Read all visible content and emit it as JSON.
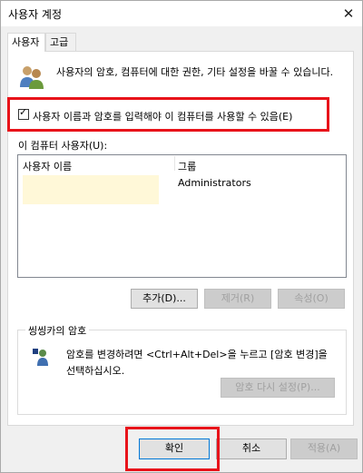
{
  "window": {
    "title": "사용자 계정",
    "close_glyph": "✕"
  },
  "tabs": [
    {
      "label": "사용자",
      "active": true
    },
    {
      "label": "고급",
      "active": false
    }
  ],
  "description": "사용자의 암호, 컴퓨터에 대한 권한, 기타 설정을 바꿀 수 있습니다.",
  "checkbox": {
    "checked": true,
    "label": "사용자 이름과 암호를 입력해야 이 컴퓨터를 사용할 수 있음(E)"
  },
  "users_list": {
    "label": "이 컴퓨터 사용자(U):",
    "columns": [
      "사용자 이름",
      "그룹"
    ],
    "rows": [
      {
        "name": "",
        "group": "Administrators"
      }
    ]
  },
  "user_buttons": {
    "add": "추가(D)...",
    "remove": "제거(R)",
    "properties": "속성(O)"
  },
  "password_group": {
    "title": "씽씽카의 암호",
    "text_line1": "암호를 변경하려면 <Ctrl+Alt+Del>을 누르고 [암호 변경]을",
    "text_line2": "선택하십시오.",
    "reset_button": "암호 다시 설정(P)..."
  },
  "dialog_buttons": {
    "ok": "확인",
    "cancel": "취소",
    "apply": "적용(A)"
  },
  "colors": {
    "highlight": "#e8131a",
    "focus": "#0078d7"
  },
  "icons": {
    "users": "users-icon",
    "password": "key-user-icon",
    "close": "close-icon"
  }
}
